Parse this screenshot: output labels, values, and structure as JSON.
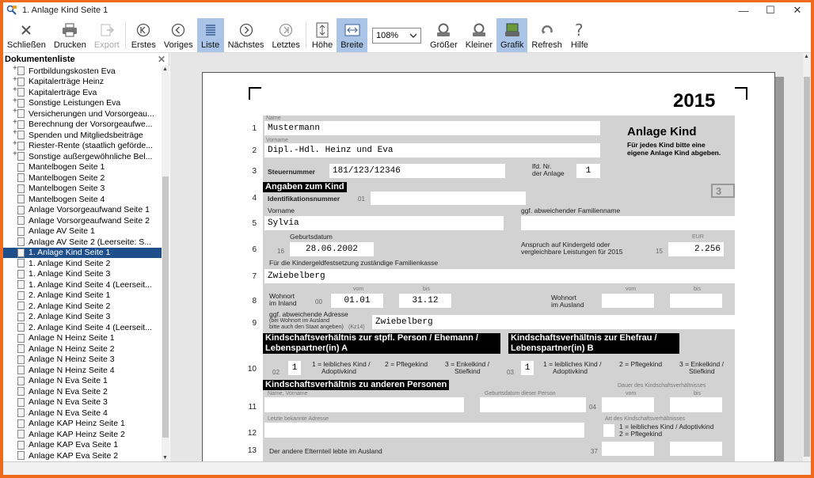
{
  "window": {
    "title": "1. Anlage Kind Seite 1"
  },
  "toolbar": {
    "close": "Schließen",
    "print": "Drucken",
    "export": "Export",
    "first": "Erstes",
    "prev": "Voriges",
    "list": "Liste",
    "next": "Nächstes",
    "last": "Letztes",
    "height": "Höhe",
    "width": "Breite",
    "zoom": "108%",
    "bigger": "Größer",
    "smaller": "Kleiner",
    "graphic": "Grafik",
    "refresh": "Refresh",
    "help": "Hilfe"
  },
  "sidebar": {
    "title": "Dokumentenliste",
    "items": [
      "Fortbildungskosten Eva",
      "Kapitalerträge Heinz",
      "Kapitalerträge Eva",
      "Sonstige Leistungen Eva",
      "Versicherungen und Vorsorgeau...",
      "Berechnung der Vorsorgeaufwe...",
      "Spenden und Mitgliedsbeiträge",
      "Riester-Rente (staatlich geförde...",
      "Sonstige außergewöhnliche Bel...",
      "Mantelbogen Seite 1",
      "Mantelbogen Seite 2",
      "Mantelbogen Seite 3",
      "Mantelbogen Seite 4",
      "Anlage Vorsorgeaufwand Seite 1",
      "Anlage Vorsorgeaufwand Seite 2",
      "Anlage AV Seite 1",
      "Anlage AV Seite 2 (Leerseite: S...",
      "1. Anlage Kind Seite 1",
      "1. Anlage Kind Seite 2",
      "1. Anlage Kind Seite 3",
      "1. Anlage Kind Seite 4 (Leerseit...",
      "2. Anlage Kind Seite 1",
      "2. Anlage Kind Seite 2",
      "2. Anlage Kind Seite 3",
      "2. Anlage Kind Seite 4 (Leerseit...",
      "Anlage N Heinz Seite 1",
      "Anlage N Heinz Seite 2",
      "Anlage N Heinz Seite 3",
      "Anlage N Heinz Seite 4",
      "Anlage N Eva Seite 1",
      "Anlage N Eva Seite 2",
      "Anlage N Eva Seite 3",
      "Anlage N Eva Seite 4",
      "Anlage KAP Heinz Seite 1",
      "Anlage KAP Heinz Seite 2",
      "Anlage KAP Eva Seite 1",
      "Anlage KAP Eva Seite 2"
    ],
    "selected_index": 17
  },
  "form": {
    "year": "2015",
    "heading": "Anlage Kind",
    "subheading1": "Für jedes Kind bitte eine",
    "subheading2": "eigene Anlage Kind abgeben.",
    "label_name": "Name",
    "value_name": "Mustermann",
    "label_vorname": "Vorname",
    "value_vorname": "Dipl.-Hdl. Heinz und Eva",
    "label_steuernummer": "Steuernummer",
    "value_steuernummer": "181/123/12346",
    "label_lfd1": "lfd. Nr.",
    "label_lfd2": "der Anlage",
    "value_lfd": "1",
    "box_number": "3",
    "section_kind": "Angaben zum Kind",
    "label_idnr": "Identifikationsnummer",
    "code_01": "01",
    "label_kind_vorname": "Vorname",
    "label_abw_familienname": "ggf. abweichender Familienname",
    "value_kind_vorname": "Sylvia",
    "label_geburtsdatum": "Geburtsdatum",
    "code_16": "16",
    "value_geburtsdatum": "28.06.2002",
    "label_anspruch1": "Anspruch auf Kindergeld oder",
    "label_anspruch2": "vergleichbare Leistungen für 2015",
    "code_15": "15",
    "label_eur": "EUR",
    "value_kindergeld": "2.256",
    "label_familienkasse": "Für die Kindergeldfestsetzung zuständige Familienkasse",
    "value_familienkasse": "Zwiebelberg",
    "label_wohnort_inland1": "Wohnort",
    "label_wohnort_inland2": "im Inland",
    "code_00": "00",
    "label_vom": "vom",
    "label_bis": "bis",
    "value_vom": "01.01",
    "value_bis": "31.12",
    "label_wohnort_ausland1": "Wohnort",
    "label_wohnort_ausland2": "im Ausland",
    "label_abw_adresse": "ggf. abweichende Adresse",
    "label_abw_adresse_sub1": "(bei Wohnort im Ausland",
    "label_abw_adresse_sub2": "bitte auch den Staat angeben)",
    "code_kz14": "(Kz14)",
    "value_adresse": "Zwiebelberg",
    "section_a1": "Kindschaftsverhältnis zur stpfl. Person / Ehemann /",
    "section_a2": "Lebenspartner(in) A",
    "section_b1": "Kindschaftsverhältnis zur Ehefrau /",
    "section_b2": "Lebenspartner(in) B",
    "code_02": "02",
    "value_a": "1",
    "opt1a": "1 = leibliches Kind /",
    "opt1b": "Adoptivkind",
    "opt2": "2 = Pflegekind",
    "opt3a": "3 = Enkelkind /",
    "opt3b": "Stiefkind",
    "code_03": "03",
    "value_b": "1",
    "section_others": "Kindschaftsverhältnis zu anderen Personen",
    "label_dauer": "Dauer des Kindschaftsverhältnisses",
    "label_name_vorname": "Name, Vorname",
    "label_geb_person": "Geburtsdatum dieser Person",
    "code_04": "04",
    "label_letzte_adresse": "Letzte bekannte Adresse",
    "label_art": "Art des Kindschaftsverhältnisses",
    "art1": "1 = leibliches Kind / Adoptivkind",
    "art2": "2 = Pflegekind",
    "label_elternteil": "Der andere Elternteil lebte im Ausland",
    "code_37": "37",
    "line_numbers": [
      "1",
      "2",
      "3",
      "4",
      "5",
      "6",
      "7",
      "8",
      "9",
      "10",
      "11",
      "12",
      "13"
    ]
  }
}
